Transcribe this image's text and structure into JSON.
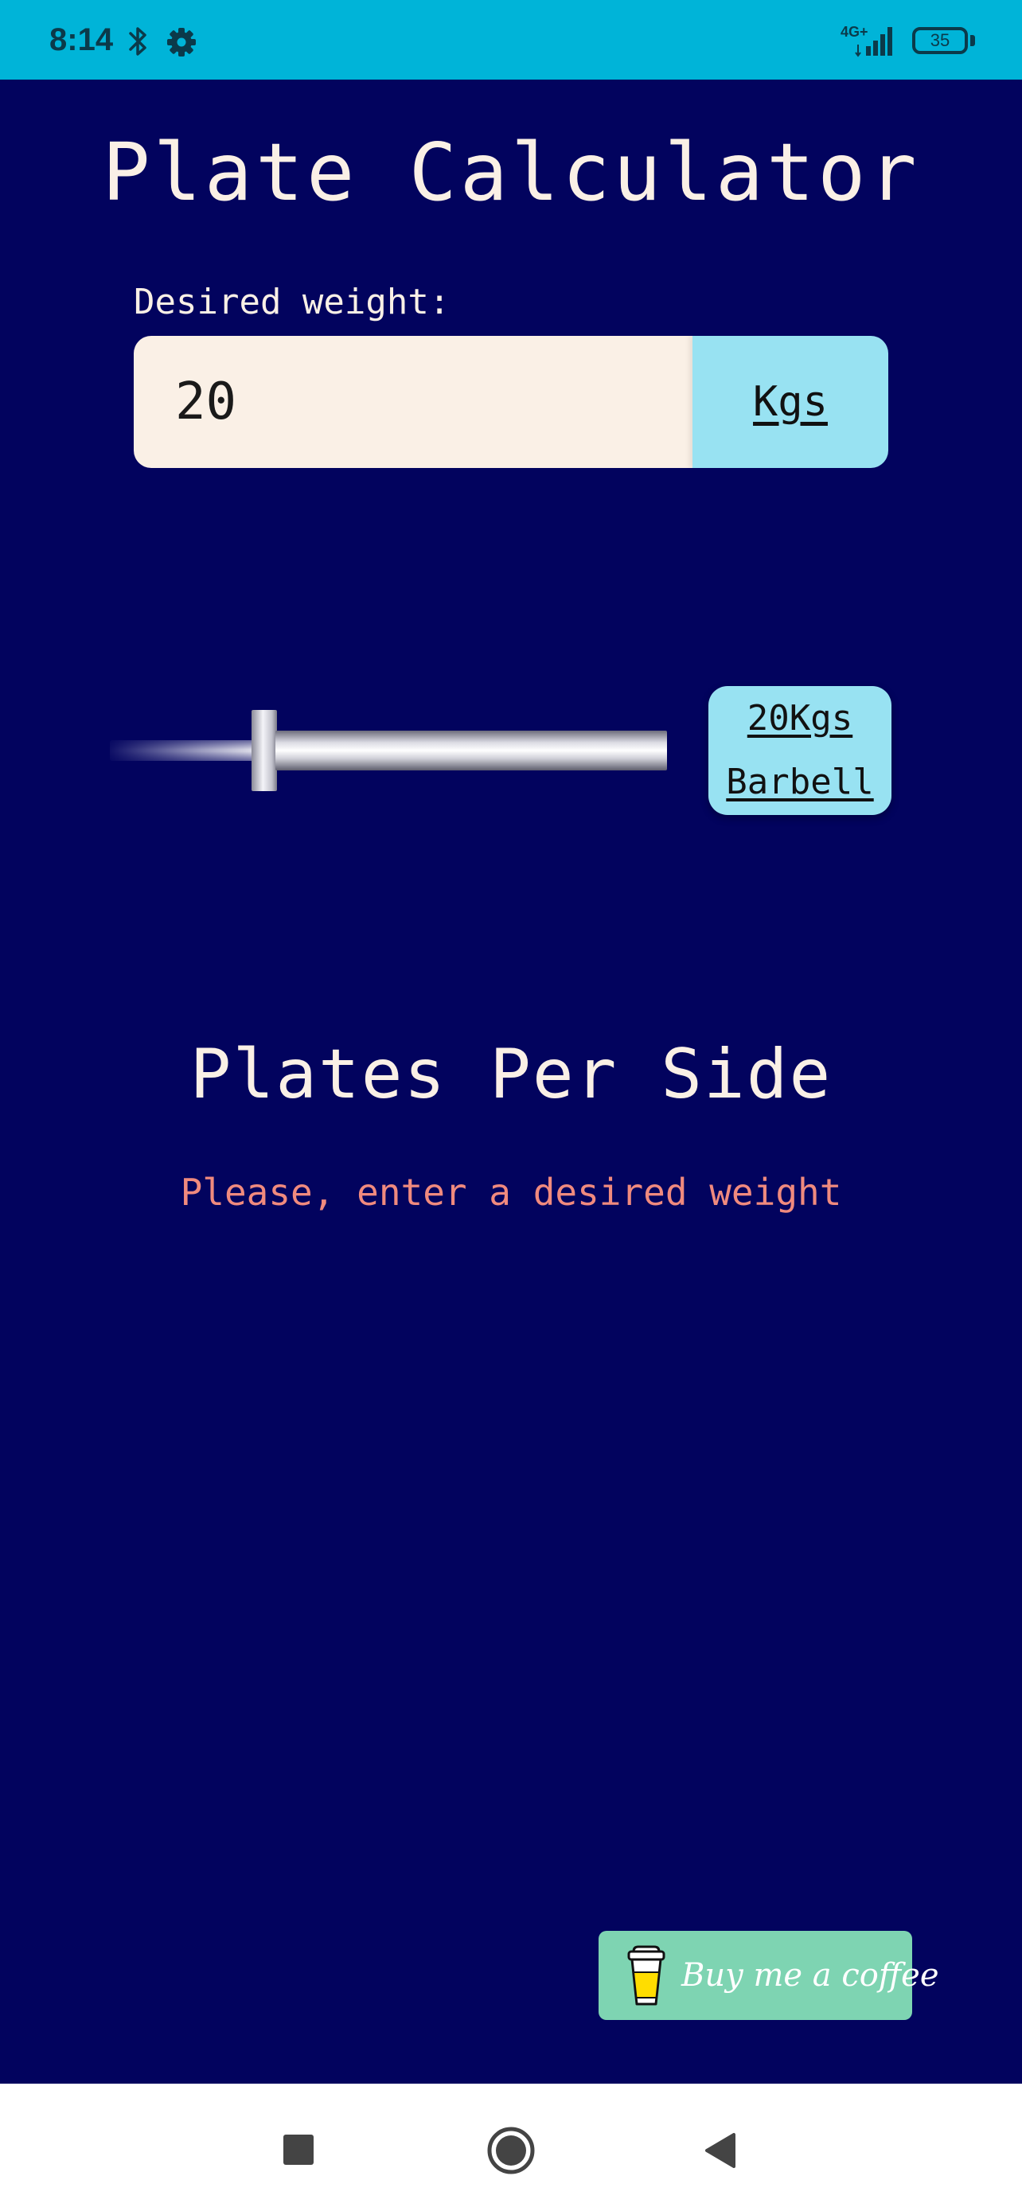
{
  "status_bar": {
    "time": "8:14",
    "network": "4G+",
    "battery": "35",
    "icons": [
      "bluetooth-icon",
      "gear-icon",
      "signal-icon",
      "battery-icon"
    ],
    "background_color": "#00b4d8"
  },
  "app": {
    "title": "Plate Calculator",
    "background_color": "#02035e"
  },
  "weight_form": {
    "label": "Desired weight:",
    "value": "20",
    "unit_label": "Kgs"
  },
  "barbell": {
    "weight_label": "20Kgs",
    "type_label": "Barbell"
  },
  "results": {
    "heading": "Plates Per Side",
    "message": "Please, enter a desired weight",
    "message_color": "#f08a7e"
  },
  "coffee": {
    "label": "Buy me a coffee",
    "icon": "coffee-cup-icon",
    "color": "#7ed4b2"
  },
  "navigation": {
    "buttons": [
      "recents-button",
      "home-button",
      "back-button"
    ]
  }
}
